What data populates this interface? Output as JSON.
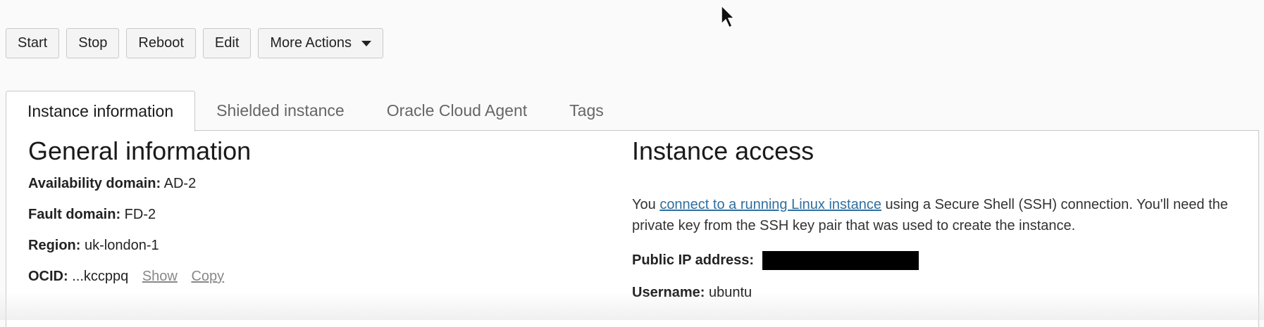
{
  "toolbar": {
    "start": "Start",
    "stop": "Stop",
    "reboot": "Reboot",
    "edit": "Edit",
    "more_actions": "More Actions"
  },
  "tabs": [
    {
      "label": "Instance information",
      "active": true
    },
    {
      "label": "Shielded instance",
      "active": false
    },
    {
      "label": "Oracle Cloud Agent",
      "active": false
    },
    {
      "label": "Tags",
      "active": false
    }
  ],
  "general": {
    "title": "General information",
    "availability_label": "Availability domain:",
    "availability_value": "AD-2",
    "fault_label": "Fault domain:",
    "fault_value": "FD-2",
    "region_label": "Region:",
    "region_value": "uk-london-1",
    "ocid_label": "OCID:",
    "ocid_value": "...kccppq",
    "show_link": "Show",
    "copy_link": "Copy"
  },
  "access": {
    "title": "Instance access",
    "text_before": "You ",
    "link_text": "connect to a running Linux instance",
    "text_after": " using a Secure Shell (SSH) connection. You'll need the private key from the SSH key pair that was used to create the instance.",
    "public_ip_label": "Public IP address:",
    "username_label": "Username:",
    "username_value": "ubuntu"
  },
  "colors": {
    "link": "#2f6f9f",
    "border": "#c9c9c9"
  }
}
